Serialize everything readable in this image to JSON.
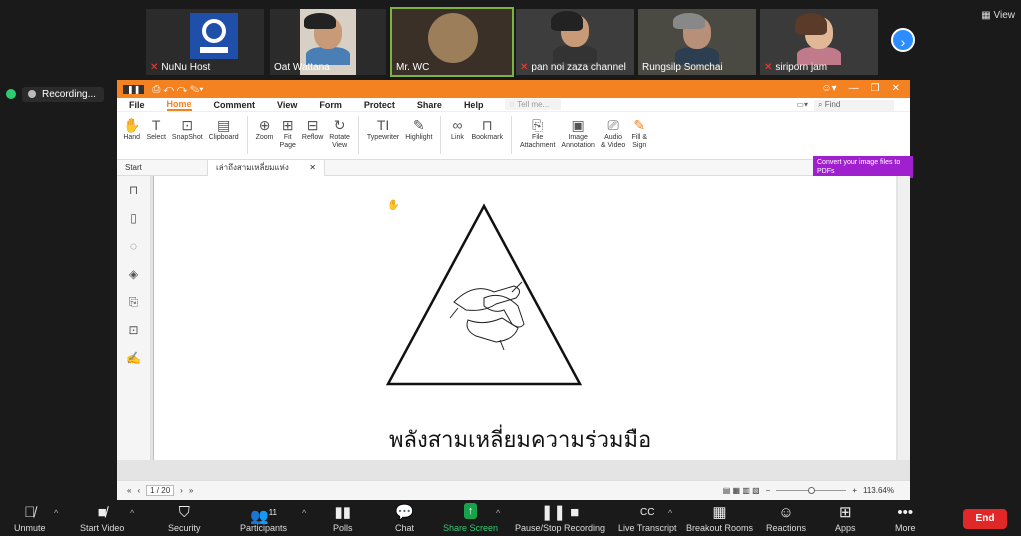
{
  "participants": [
    {
      "name": "NuNu Host",
      "muted": true
    },
    {
      "name": "Oat Wattana",
      "muted": false
    },
    {
      "name": "Mr. WC",
      "muted": false
    },
    {
      "name": "pan noi zaza channel",
      "muted": true
    },
    {
      "name": "Rungsilp Somchai",
      "muted": false
    },
    {
      "name": "siriporn jam",
      "muted": true
    }
  ],
  "view_label": "View",
  "recording_label": "Recording...",
  "pdf": {
    "menus": [
      "File",
      "Home",
      "Comment",
      "View",
      "Form",
      "Protect",
      "Share",
      "Help"
    ],
    "tell_me": "Tell me...",
    "find": "Find",
    "tools": [
      {
        "icon": "hand-icon",
        "label": "Hand"
      },
      {
        "icon": "select-icon",
        "label": "Select"
      },
      {
        "icon": "snapshot-icon",
        "label": "SnapShot"
      },
      {
        "icon": "clipboard-icon",
        "label": "Clipboard"
      },
      {
        "icon": "zoom-icon",
        "label": "Zoom"
      },
      {
        "icon": "fit-page-icon",
        "label": "Fit\nPage"
      },
      {
        "icon": "reflow-icon",
        "label": "Reflow"
      },
      {
        "icon": "rotate-icon",
        "label": "Rotate\nView"
      },
      {
        "icon": "typewriter-icon",
        "label": "Typewriter"
      },
      {
        "icon": "highlight-icon",
        "label": "Highlight"
      },
      {
        "icon": "link-icon",
        "label": "Link"
      },
      {
        "icon": "bookmark-icon",
        "label": "Bookmark"
      },
      {
        "icon": "file-attachment-icon",
        "label": "File\nAttachment"
      },
      {
        "icon": "image-annotation-icon",
        "label": "Image\nAnnotation"
      },
      {
        "icon": "audio-video-icon",
        "label": "Audio\n& Video"
      },
      {
        "icon": "fill-sign-icon",
        "label": "Fill &\nSign"
      }
    ],
    "tabs": {
      "start": "Start",
      "doc": "เล่าถึงสามเหลี่ยมแห่งความ...",
      "close": "✕"
    },
    "promo": "Convert your image files to PDFs",
    "caption": "พลังสามเหลี่ยมความร่วมมือ",
    "page_indicator": "1 / 20",
    "zoom_level": "113.64%"
  },
  "toolbar": {
    "unmute": "Unmute",
    "start_video": "Start Video",
    "security": "Security",
    "participants": "Participants",
    "participants_count": "11",
    "polls": "Polls",
    "chat": "Chat",
    "share_screen": "Share Screen",
    "pause_recording": "Pause/Stop Recording",
    "live_transcript": "Live Transcript",
    "breakout_rooms": "Breakout Rooms",
    "reactions": "Reactions",
    "apps": "Apps",
    "more": "More",
    "end": "End"
  },
  "colors": {
    "foxit_orange": "#f58220",
    "zoom_blue": "#2d8cff",
    "end_red": "#e02828",
    "share_green": "#17a34a"
  }
}
